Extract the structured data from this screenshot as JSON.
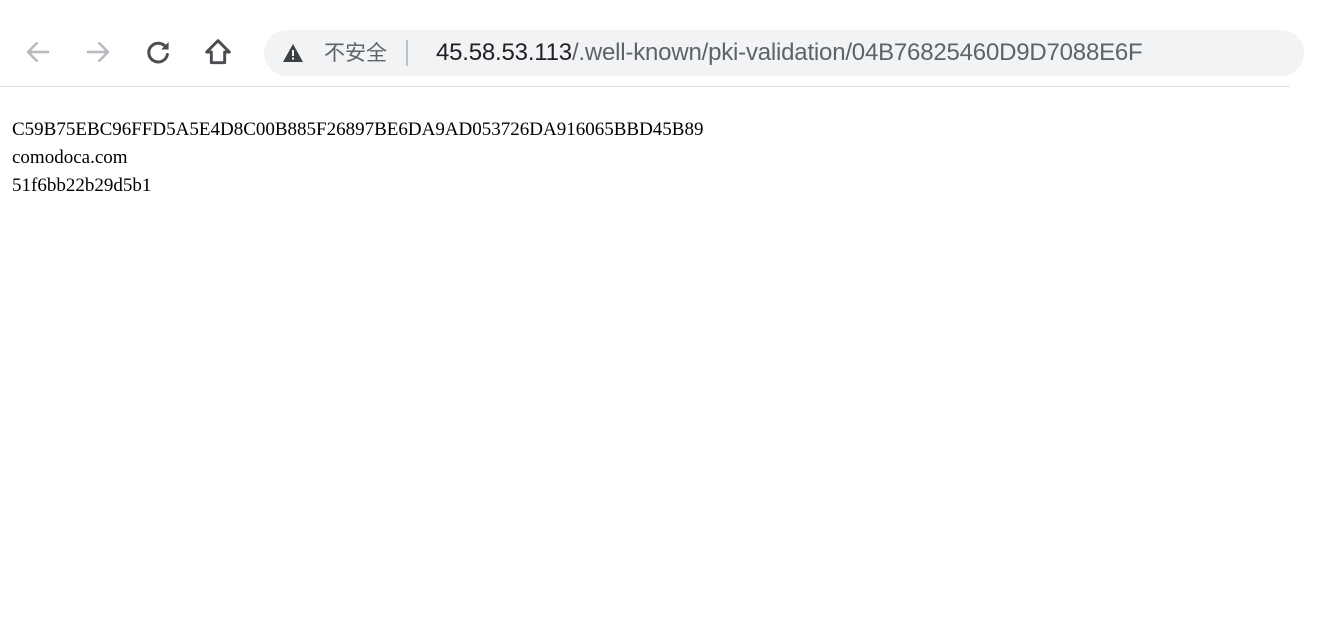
{
  "toolbar": {
    "back_icon": "arrow-left-icon",
    "forward_icon": "arrow-right-icon",
    "reload_icon": "reload-icon",
    "home_icon": "home-icon"
  },
  "address_bar": {
    "security_icon": "warning-triangle-icon",
    "security_label": "不安全",
    "url_host": "45.58.53.113",
    "url_path": "/.well-known/pki-validation/04B76825460D9D7088E6F"
  },
  "document": {
    "lines": [
      "C59B75EBC96FFD5A5E4D8C00B885F26897BE6DA9AD053726DA916065BBD45B89",
      "comodoca.com",
      "51f6bb22b29d5b1"
    ]
  },
  "colors": {
    "toolbar_icon": "#5f6368",
    "omnibox_bg": "#f1f3f4",
    "text": "#000000"
  }
}
